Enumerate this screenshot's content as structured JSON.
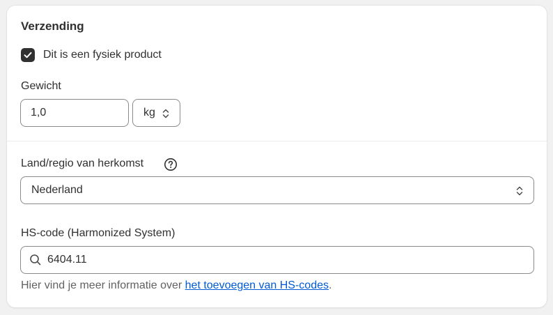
{
  "shipping": {
    "title": "Verzending",
    "physical_checkbox": {
      "label": "Dit is een fysiek product",
      "checked": true
    },
    "weight": {
      "label": "Gewicht",
      "value": "1,0",
      "unit": "kg"
    }
  },
  "customs": {
    "country": {
      "label": "Land/regio van herkomst",
      "value": "Nederland"
    },
    "hs_code": {
      "label": "HS-code (Harmonized System)",
      "value": "6404.11"
    },
    "helper": {
      "prefix": "Hier vind je meer informatie over ",
      "link": "het toevoegen van HS-codes",
      "suffix": "."
    }
  },
  "icons": {
    "checkbox": "checkmark-icon",
    "unit_chevron": "chevron-up-down-icon",
    "help": "question-circle-icon",
    "country_chevron": "chevron-up-down-icon",
    "search": "search-icon"
  },
  "colors": {
    "accent": "#303030",
    "link": "#005bd3",
    "border": "#8a8a8a"
  }
}
